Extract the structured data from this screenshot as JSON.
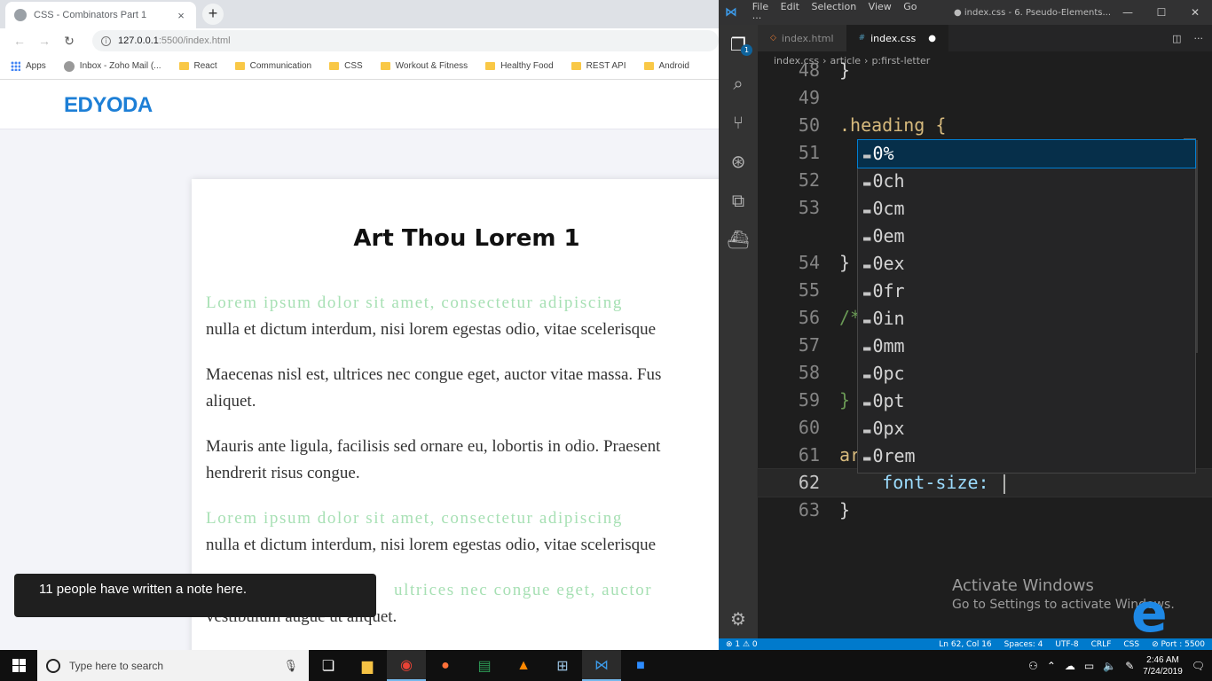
{
  "browser": {
    "tab_title": "CSS - Combinators Part 1",
    "tab_close": "×",
    "new_tab": "+",
    "url_host": "127.0.0.1",
    "url_path": ":5500/index.html",
    "bookmarks": [
      "Apps",
      "Inbox - Zoho Mail (...",
      "React",
      "Communication",
      "CSS",
      "Workout & Fitness",
      "Healthy Food",
      "REST API",
      "Android"
    ]
  },
  "page": {
    "logo": "EDYODA",
    "heading": "Art Thou Lorem 1",
    "paragraphs": [
      {
        "first": "Lorem ipsum dolor sit amet, consectetur adipiscing",
        "rest": "nulla et dictum interdum, nisi lorem egestas odio, vitae scelerisque"
      },
      {
        "first": "",
        "rest": "Maecenas nisl est, ultrices nec congue eget, auctor vitae massa. Fus",
        "rest2": "aliquet."
      },
      {
        "first": "",
        "rest": "Mauris ante ligula, facilisis sed ornare eu, lobortis in odio. Praesent",
        "rest2": "hendrerit risus congue."
      },
      {
        "first": "Lorem ipsum dolor sit amet, consectetur adipiscing",
        "rest": "nulla et dictum interdum, nisi lorem egestas odio, vitae scelerisque"
      },
      {
        "first": "ultrices nec congue eget, auctor",
        "rest": "vestibulum augue ut aliquet."
      }
    ]
  },
  "note_toast": "11 people have written a note here.",
  "vscode": {
    "menu": [
      "File",
      "Edit",
      "Selection",
      "View",
      "Go",
      "···"
    ],
    "window_title": "● index.css - 6. Pseudo-Elements...",
    "tabs": [
      {
        "label": "index.html",
        "active": false
      },
      {
        "label": "index.css",
        "active": true
      }
    ],
    "breadcrumbs": [
      "index.css",
      "article",
      "p:first-letter"
    ],
    "lines": [
      {
        "n": "48",
        "code": "}"
      },
      {
        "n": "49",
        "code": ""
      },
      {
        "n": "50",
        "code": ".heading {"
      },
      {
        "n": "51",
        "code": ""
      },
      {
        "n": "52",
        "code": ""
      },
      {
        "n": "53",
        "code": ""
      },
      {
        "n": "",
        "code": ""
      },
      {
        "n": "54",
        "code": "}"
      },
      {
        "n": "55",
        "code": ""
      },
      {
        "n": "56",
        "code": "/*"
      },
      {
        "n": "57",
        "code": ""
      },
      {
        "n": "58",
        "code": ""
      },
      {
        "n": "59",
        "code": "}"
      },
      {
        "n": "60",
        "code": ""
      },
      {
        "n": "61",
        "code": "ar"
      },
      {
        "n": "62",
        "code": "    font-size: "
      },
      {
        "n": "63",
        "code": "}"
      }
    ],
    "suggestions": [
      "0%",
      "0ch",
      "0cm",
      "0em",
      "0ex",
      "0fr",
      "0in",
      "0mm",
      "0pc",
      "0pt",
      "0px",
      "0rem"
    ],
    "status_left": "⊗ 1 ⚠ 0",
    "status_right": [
      "Ln 62, Col 16",
      "Spaces: 4",
      "UTF-8",
      "CRLF",
      "CSS",
      "⊘ Port : 5500"
    ]
  },
  "watermark": {
    "line1": "Activate Windows",
    "line2": "Go to Settings to activate Windows."
  },
  "taskbar": {
    "search_placeholder": "Type here to search",
    "time": "2:46 AM",
    "date": "7/24/2019"
  },
  "colors": {
    "edyoda_blue": "#1d7fd6",
    "first_line_green": "#a7e0b4",
    "vscode_status": "#007acc"
  }
}
